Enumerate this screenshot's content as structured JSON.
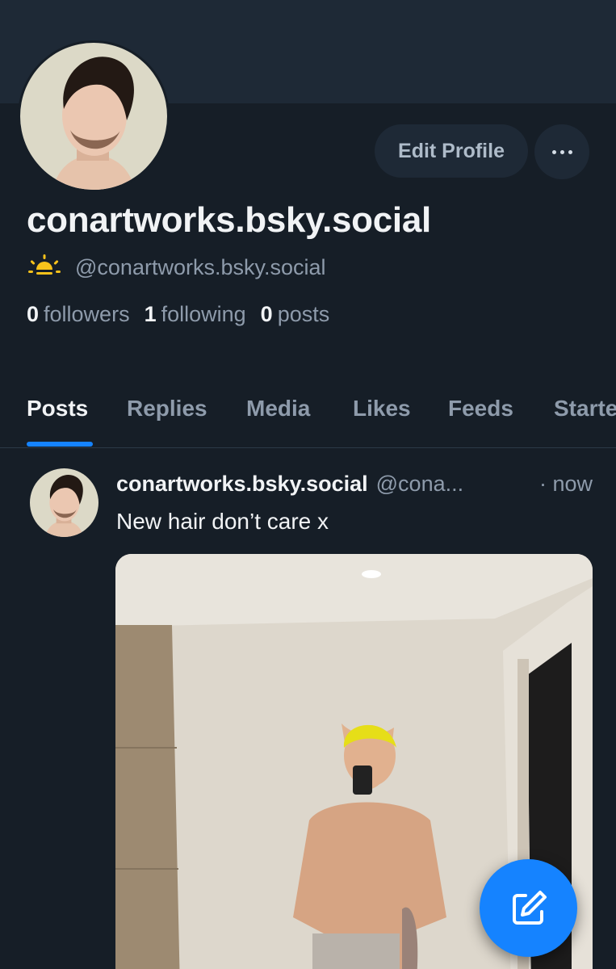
{
  "profile": {
    "display_name": "conartworks.bsky.social",
    "handle": "@conartworks.bsky.social",
    "handle_icon": "sunrise-icon",
    "edit_button_label": "Edit Profile",
    "more_icon": "more-horizontal-icon",
    "stats": {
      "followers_count": "0",
      "followers_label": "followers",
      "following_count": "1",
      "following_label": "following",
      "posts_count": "0",
      "posts_label": "posts"
    }
  },
  "tabs": [
    {
      "label": "Posts",
      "active": true
    },
    {
      "label": "Replies",
      "active": false
    },
    {
      "label": "Media",
      "active": false
    },
    {
      "label": "Likes",
      "active": false
    },
    {
      "label": "Feeds",
      "active": false
    },
    {
      "label": "Starter Packs",
      "active": false
    }
  ],
  "post": {
    "author": "conartworks.bsky.social",
    "handle": "@cona...",
    "time": "· now",
    "text": "New hair don’t care x"
  },
  "compose_icon": "compose-icon",
  "colors": {
    "background": "#161e27",
    "banner": "#1e2936",
    "accent": "#1583ff",
    "muted_text": "#8e9bab",
    "primary_text": "#f1f3f5"
  }
}
